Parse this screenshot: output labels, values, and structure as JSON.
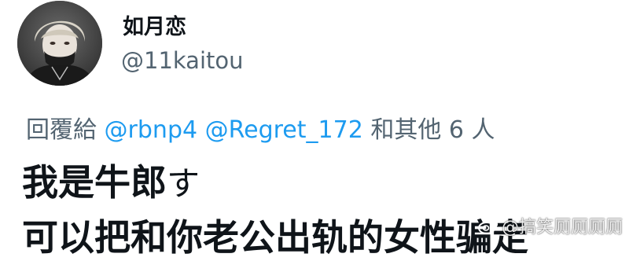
{
  "author": {
    "display_name": "如月恋",
    "handle": "@11kaitou",
    "avatar_icon": "user-avatar-photo"
  },
  "reply": {
    "prefix": "回覆給",
    "mentions": [
      "@rbnp4",
      "@Regret_172"
    ],
    "suffix": "和其他 6 人"
  },
  "tweet": {
    "line1_main": "我是牛郎",
    "line1_tail": "す",
    "line2": "可以把和你老公出轨的女性骗走"
  },
  "watermark": {
    "icon": "weibo-logo-icon",
    "text": "@搞笑厕厕厕厕"
  },
  "colors": {
    "text_primary": "#0f1419",
    "text_secondary": "#536471",
    "mention": "#1d9bf0"
  }
}
